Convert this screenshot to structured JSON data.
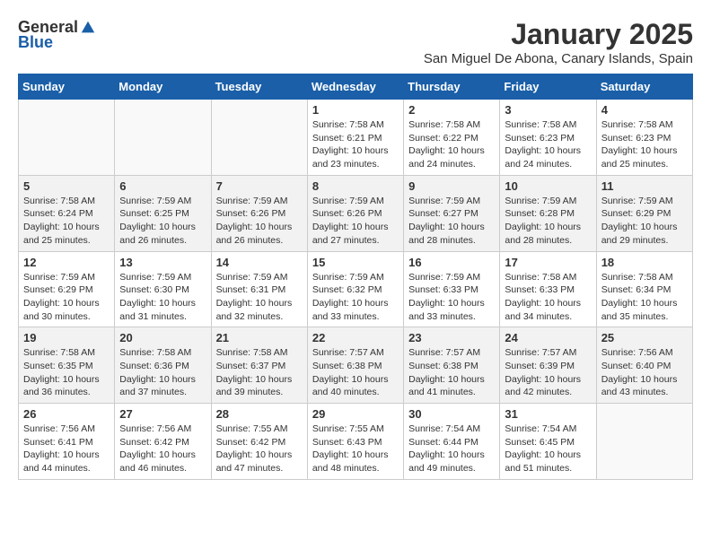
{
  "header": {
    "logo_general": "General",
    "logo_blue": "Blue",
    "month_title": "January 2025",
    "subtitle": "San Miguel De Abona, Canary Islands, Spain"
  },
  "days_of_week": [
    "Sunday",
    "Monday",
    "Tuesday",
    "Wednesday",
    "Thursday",
    "Friday",
    "Saturday"
  ],
  "weeks": [
    {
      "shaded": false,
      "days": [
        {
          "number": "",
          "detail": ""
        },
        {
          "number": "",
          "detail": ""
        },
        {
          "number": "",
          "detail": ""
        },
        {
          "number": "1",
          "detail": "Sunrise: 7:58 AM\nSunset: 6:21 PM\nDaylight: 10 hours\nand 23 minutes."
        },
        {
          "number": "2",
          "detail": "Sunrise: 7:58 AM\nSunset: 6:22 PM\nDaylight: 10 hours\nand 24 minutes."
        },
        {
          "number": "3",
          "detail": "Sunrise: 7:58 AM\nSunset: 6:23 PM\nDaylight: 10 hours\nand 24 minutes."
        },
        {
          "number": "4",
          "detail": "Sunrise: 7:58 AM\nSunset: 6:23 PM\nDaylight: 10 hours\nand 25 minutes."
        }
      ]
    },
    {
      "shaded": true,
      "days": [
        {
          "number": "5",
          "detail": "Sunrise: 7:58 AM\nSunset: 6:24 PM\nDaylight: 10 hours\nand 25 minutes."
        },
        {
          "number": "6",
          "detail": "Sunrise: 7:59 AM\nSunset: 6:25 PM\nDaylight: 10 hours\nand 26 minutes."
        },
        {
          "number": "7",
          "detail": "Sunrise: 7:59 AM\nSunset: 6:26 PM\nDaylight: 10 hours\nand 26 minutes."
        },
        {
          "number": "8",
          "detail": "Sunrise: 7:59 AM\nSunset: 6:26 PM\nDaylight: 10 hours\nand 27 minutes."
        },
        {
          "number": "9",
          "detail": "Sunrise: 7:59 AM\nSunset: 6:27 PM\nDaylight: 10 hours\nand 28 minutes."
        },
        {
          "number": "10",
          "detail": "Sunrise: 7:59 AM\nSunset: 6:28 PM\nDaylight: 10 hours\nand 28 minutes."
        },
        {
          "number": "11",
          "detail": "Sunrise: 7:59 AM\nSunset: 6:29 PM\nDaylight: 10 hours\nand 29 minutes."
        }
      ]
    },
    {
      "shaded": false,
      "days": [
        {
          "number": "12",
          "detail": "Sunrise: 7:59 AM\nSunset: 6:29 PM\nDaylight: 10 hours\nand 30 minutes."
        },
        {
          "number": "13",
          "detail": "Sunrise: 7:59 AM\nSunset: 6:30 PM\nDaylight: 10 hours\nand 31 minutes."
        },
        {
          "number": "14",
          "detail": "Sunrise: 7:59 AM\nSunset: 6:31 PM\nDaylight: 10 hours\nand 32 minutes."
        },
        {
          "number": "15",
          "detail": "Sunrise: 7:59 AM\nSunset: 6:32 PM\nDaylight: 10 hours\nand 33 minutes."
        },
        {
          "number": "16",
          "detail": "Sunrise: 7:59 AM\nSunset: 6:33 PM\nDaylight: 10 hours\nand 33 minutes."
        },
        {
          "number": "17",
          "detail": "Sunrise: 7:58 AM\nSunset: 6:33 PM\nDaylight: 10 hours\nand 34 minutes."
        },
        {
          "number": "18",
          "detail": "Sunrise: 7:58 AM\nSunset: 6:34 PM\nDaylight: 10 hours\nand 35 minutes."
        }
      ]
    },
    {
      "shaded": true,
      "days": [
        {
          "number": "19",
          "detail": "Sunrise: 7:58 AM\nSunset: 6:35 PM\nDaylight: 10 hours\nand 36 minutes."
        },
        {
          "number": "20",
          "detail": "Sunrise: 7:58 AM\nSunset: 6:36 PM\nDaylight: 10 hours\nand 37 minutes."
        },
        {
          "number": "21",
          "detail": "Sunrise: 7:58 AM\nSunset: 6:37 PM\nDaylight: 10 hours\nand 39 minutes."
        },
        {
          "number": "22",
          "detail": "Sunrise: 7:57 AM\nSunset: 6:38 PM\nDaylight: 10 hours\nand 40 minutes."
        },
        {
          "number": "23",
          "detail": "Sunrise: 7:57 AM\nSunset: 6:38 PM\nDaylight: 10 hours\nand 41 minutes."
        },
        {
          "number": "24",
          "detail": "Sunrise: 7:57 AM\nSunset: 6:39 PM\nDaylight: 10 hours\nand 42 minutes."
        },
        {
          "number": "25",
          "detail": "Sunrise: 7:56 AM\nSunset: 6:40 PM\nDaylight: 10 hours\nand 43 minutes."
        }
      ]
    },
    {
      "shaded": false,
      "days": [
        {
          "number": "26",
          "detail": "Sunrise: 7:56 AM\nSunset: 6:41 PM\nDaylight: 10 hours\nand 44 minutes."
        },
        {
          "number": "27",
          "detail": "Sunrise: 7:56 AM\nSunset: 6:42 PM\nDaylight: 10 hours\nand 46 minutes."
        },
        {
          "number": "28",
          "detail": "Sunrise: 7:55 AM\nSunset: 6:42 PM\nDaylight: 10 hours\nand 47 minutes."
        },
        {
          "number": "29",
          "detail": "Sunrise: 7:55 AM\nSunset: 6:43 PM\nDaylight: 10 hours\nand 48 minutes."
        },
        {
          "number": "30",
          "detail": "Sunrise: 7:54 AM\nSunset: 6:44 PM\nDaylight: 10 hours\nand 49 minutes."
        },
        {
          "number": "31",
          "detail": "Sunrise: 7:54 AM\nSunset: 6:45 PM\nDaylight: 10 hours\nand 51 minutes."
        },
        {
          "number": "",
          "detail": ""
        }
      ]
    }
  ]
}
